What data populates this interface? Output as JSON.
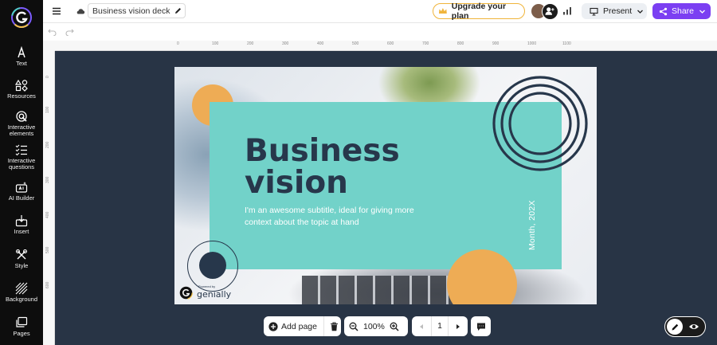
{
  "app": {
    "document_title": "Business vision deck",
    "upgrade_label": "Upgrade your plan",
    "present_label": "Present",
    "share_label": "Share"
  },
  "sidebar": {
    "items": [
      {
        "label": "Text",
        "icon": "text-icon"
      },
      {
        "label": "Resources",
        "icon": "resources-icon"
      },
      {
        "label": "Interactive\nelements",
        "icon": "interactive-elements-icon"
      },
      {
        "label": "Interactive\nquestions",
        "icon": "interactive-questions-icon"
      },
      {
        "label": "AI Builder",
        "icon": "ai-builder-icon"
      },
      {
        "label": "Insert",
        "icon": "insert-icon"
      },
      {
        "label": "Style",
        "icon": "style-icon"
      },
      {
        "label": "Background",
        "icon": "background-icon"
      },
      {
        "label": "Pages",
        "icon": "pages-icon"
      }
    ]
  },
  "rulers": {
    "top": [
      "0",
      "100",
      "200",
      "300",
      "400",
      "500",
      "600",
      "700",
      "800",
      "900",
      "1000",
      "1100"
    ],
    "left": [
      "0",
      "100",
      "200",
      "300",
      "400",
      "500",
      "600"
    ]
  },
  "slide": {
    "title": "Business\nvision",
    "subtitle": "I'm an awesome subtitle, ideal for giving more context about the topic at hand",
    "date": "Month, 202X",
    "powered_by": "Powered by",
    "brand": "genially"
  },
  "bottom_toolbar": {
    "add_page_label": "Add page",
    "zoom_level": "100%",
    "current_page": "1"
  },
  "colors": {
    "sidebar_bg": "#0d0d0d",
    "canvas_bg": "#283445",
    "accent_purple": "#7b3ff2",
    "slide_teal": "#72d2c9",
    "slide_orange": "#eeac55",
    "slide_navy": "#27374b",
    "upgrade_border": "#f0b43a"
  }
}
